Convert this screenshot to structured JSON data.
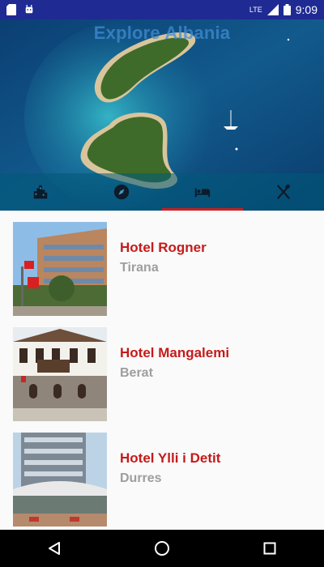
{
  "status_bar": {
    "time": "9:09",
    "network": "LTE",
    "left_icons": [
      "sd-card-icon",
      "android-icon"
    ]
  },
  "header": {
    "title": "Explore Albania"
  },
  "tabs": [
    {
      "icon": "city-icon",
      "active": false
    },
    {
      "icon": "compass-icon",
      "active": false
    },
    {
      "icon": "hotel-bed-icon",
      "active": true
    },
    {
      "icon": "restaurant-icon",
      "active": false
    }
  ],
  "hotels": [
    {
      "name": "Hotel Rogner",
      "city": "Tirana"
    },
    {
      "name": "Hotel Mangalemi",
      "city": "Berat"
    },
    {
      "name": "Hotel Ylli i Detit",
      "city": "Durres"
    }
  ],
  "colors": {
    "status_bar": "#1f2a93",
    "accent_red": "#c61a1a",
    "secondary_text": "#9e9e9e"
  }
}
